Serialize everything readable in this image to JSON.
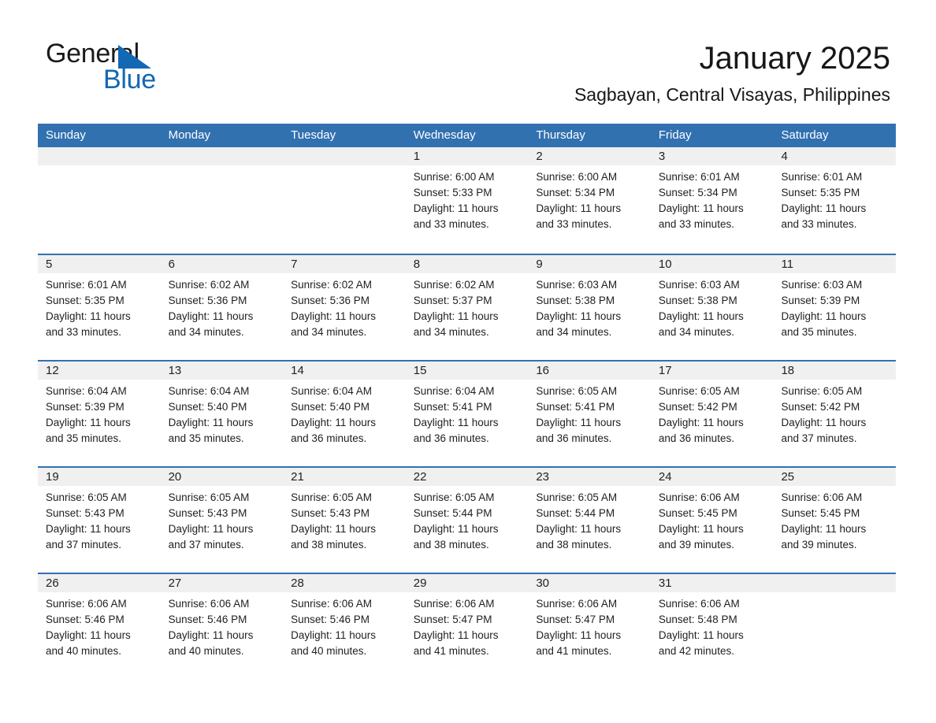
{
  "brand": {
    "word_general": "General",
    "word_blue": "Blue",
    "accent_color": "#1268b3"
  },
  "header": {
    "title": "January 2025",
    "subtitle": "Sagbayan, Central Visayas, Philippines",
    "header_bg_color": "#3271b0",
    "daynum_band_color": "#f0f0f0"
  },
  "weekday_headers": [
    "Sunday",
    "Monday",
    "Tuesday",
    "Wednesday",
    "Thursday",
    "Friday",
    "Saturday"
  ],
  "weeks": [
    [
      {
        "day": "",
        "empty": true,
        "sunrise": "",
        "sunset": "",
        "daylight1": "",
        "daylight2": ""
      },
      {
        "day": "",
        "empty": true,
        "sunrise": "",
        "sunset": "",
        "daylight1": "",
        "daylight2": ""
      },
      {
        "day": "",
        "empty": true,
        "sunrise": "",
        "sunset": "",
        "daylight1": "",
        "daylight2": ""
      },
      {
        "day": "1",
        "empty": false,
        "sunrise": "Sunrise: 6:00 AM",
        "sunset": "Sunset: 5:33 PM",
        "daylight1": "Daylight: 11 hours",
        "daylight2": "and 33 minutes."
      },
      {
        "day": "2",
        "empty": false,
        "sunrise": "Sunrise: 6:00 AM",
        "sunset": "Sunset: 5:34 PM",
        "daylight1": "Daylight: 11 hours",
        "daylight2": "and 33 minutes."
      },
      {
        "day": "3",
        "empty": false,
        "sunrise": "Sunrise: 6:01 AM",
        "sunset": "Sunset: 5:34 PM",
        "daylight1": "Daylight: 11 hours",
        "daylight2": "and 33 minutes."
      },
      {
        "day": "4",
        "empty": false,
        "sunrise": "Sunrise: 6:01 AM",
        "sunset": "Sunset: 5:35 PM",
        "daylight1": "Daylight: 11 hours",
        "daylight2": "and 33 minutes."
      }
    ],
    [
      {
        "day": "5",
        "empty": false,
        "sunrise": "Sunrise: 6:01 AM",
        "sunset": "Sunset: 5:35 PM",
        "daylight1": "Daylight: 11 hours",
        "daylight2": "and 33 minutes."
      },
      {
        "day": "6",
        "empty": false,
        "sunrise": "Sunrise: 6:02 AM",
        "sunset": "Sunset: 5:36 PM",
        "daylight1": "Daylight: 11 hours",
        "daylight2": "and 34 minutes."
      },
      {
        "day": "7",
        "empty": false,
        "sunrise": "Sunrise: 6:02 AM",
        "sunset": "Sunset: 5:36 PM",
        "daylight1": "Daylight: 11 hours",
        "daylight2": "and 34 minutes."
      },
      {
        "day": "8",
        "empty": false,
        "sunrise": "Sunrise: 6:02 AM",
        "sunset": "Sunset: 5:37 PM",
        "daylight1": "Daylight: 11 hours",
        "daylight2": "and 34 minutes."
      },
      {
        "day": "9",
        "empty": false,
        "sunrise": "Sunrise: 6:03 AM",
        "sunset": "Sunset: 5:38 PM",
        "daylight1": "Daylight: 11 hours",
        "daylight2": "and 34 minutes."
      },
      {
        "day": "10",
        "empty": false,
        "sunrise": "Sunrise: 6:03 AM",
        "sunset": "Sunset: 5:38 PM",
        "daylight1": "Daylight: 11 hours",
        "daylight2": "and 34 minutes."
      },
      {
        "day": "11",
        "empty": false,
        "sunrise": "Sunrise: 6:03 AM",
        "sunset": "Sunset: 5:39 PM",
        "daylight1": "Daylight: 11 hours",
        "daylight2": "and 35 minutes."
      }
    ],
    [
      {
        "day": "12",
        "empty": false,
        "sunrise": "Sunrise: 6:04 AM",
        "sunset": "Sunset: 5:39 PM",
        "daylight1": "Daylight: 11 hours",
        "daylight2": "and 35 minutes."
      },
      {
        "day": "13",
        "empty": false,
        "sunrise": "Sunrise: 6:04 AM",
        "sunset": "Sunset: 5:40 PM",
        "daylight1": "Daylight: 11 hours",
        "daylight2": "and 35 minutes."
      },
      {
        "day": "14",
        "empty": false,
        "sunrise": "Sunrise: 6:04 AM",
        "sunset": "Sunset: 5:40 PM",
        "daylight1": "Daylight: 11 hours",
        "daylight2": "and 36 minutes."
      },
      {
        "day": "15",
        "empty": false,
        "sunrise": "Sunrise: 6:04 AM",
        "sunset": "Sunset: 5:41 PM",
        "daylight1": "Daylight: 11 hours",
        "daylight2": "and 36 minutes."
      },
      {
        "day": "16",
        "empty": false,
        "sunrise": "Sunrise: 6:05 AM",
        "sunset": "Sunset: 5:41 PM",
        "daylight1": "Daylight: 11 hours",
        "daylight2": "and 36 minutes."
      },
      {
        "day": "17",
        "empty": false,
        "sunrise": "Sunrise: 6:05 AM",
        "sunset": "Sunset: 5:42 PM",
        "daylight1": "Daylight: 11 hours",
        "daylight2": "and 36 minutes."
      },
      {
        "day": "18",
        "empty": false,
        "sunrise": "Sunrise: 6:05 AM",
        "sunset": "Sunset: 5:42 PM",
        "daylight1": "Daylight: 11 hours",
        "daylight2": "and 37 minutes."
      }
    ],
    [
      {
        "day": "19",
        "empty": false,
        "sunrise": "Sunrise: 6:05 AM",
        "sunset": "Sunset: 5:43 PM",
        "daylight1": "Daylight: 11 hours",
        "daylight2": "and 37 minutes."
      },
      {
        "day": "20",
        "empty": false,
        "sunrise": "Sunrise: 6:05 AM",
        "sunset": "Sunset: 5:43 PM",
        "daylight1": "Daylight: 11 hours",
        "daylight2": "and 37 minutes."
      },
      {
        "day": "21",
        "empty": false,
        "sunrise": "Sunrise: 6:05 AM",
        "sunset": "Sunset: 5:43 PM",
        "daylight1": "Daylight: 11 hours",
        "daylight2": "and 38 minutes."
      },
      {
        "day": "22",
        "empty": false,
        "sunrise": "Sunrise: 6:05 AM",
        "sunset": "Sunset: 5:44 PM",
        "daylight1": "Daylight: 11 hours",
        "daylight2": "and 38 minutes."
      },
      {
        "day": "23",
        "empty": false,
        "sunrise": "Sunrise: 6:05 AM",
        "sunset": "Sunset: 5:44 PM",
        "daylight1": "Daylight: 11 hours",
        "daylight2": "and 38 minutes."
      },
      {
        "day": "24",
        "empty": false,
        "sunrise": "Sunrise: 6:06 AM",
        "sunset": "Sunset: 5:45 PM",
        "daylight1": "Daylight: 11 hours",
        "daylight2": "and 39 minutes."
      },
      {
        "day": "25",
        "empty": false,
        "sunrise": "Sunrise: 6:06 AM",
        "sunset": "Sunset: 5:45 PM",
        "daylight1": "Daylight: 11 hours",
        "daylight2": "and 39 minutes."
      }
    ],
    [
      {
        "day": "26",
        "empty": false,
        "sunrise": "Sunrise: 6:06 AM",
        "sunset": "Sunset: 5:46 PM",
        "daylight1": "Daylight: 11 hours",
        "daylight2": "and 40 minutes."
      },
      {
        "day": "27",
        "empty": false,
        "sunrise": "Sunrise: 6:06 AM",
        "sunset": "Sunset: 5:46 PM",
        "daylight1": "Daylight: 11 hours",
        "daylight2": "and 40 minutes."
      },
      {
        "day": "28",
        "empty": false,
        "sunrise": "Sunrise: 6:06 AM",
        "sunset": "Sunset: 5:46 PM",
        "daylight1": "Daylight: 11 hours",
        "daylight2": "and 40 minutes."
      },
      {
        "day": "29",
        "empty": false,
        "sunrise": "Sunrise: 6:06 AM",
        "sunset": "Sunset: 5:47 PM",
        "daylight1": "Daylight: 11 hours",
        "daylight2": "and 41 minutes."
      },
      {
        "day": "30",
        "empty": false,
        "sunrise": "Sunrise: 6:06 AM",
        "sunset": "Sunset: 5:47 PM",
        "daylight1": "Daylight: 11 hours",
        "daylight2": "and 41 minutes."
      },
      {
        "day": "31",
        "empty": false,
        "sunrise": "Sunrise: 6:06 AM",
        "sunset": "Sunset: 5:48 PM",
        "daylight1": "Daylight: 11 hours",
        "daylight2": "and 42 minutes."
      },
      {
        "day": "",
        "empty": true,
        "sunrise": "",
        "sunset": "",
        "daylight1": "",
        "daylight2": ""
      }
    ]
  ]
}
